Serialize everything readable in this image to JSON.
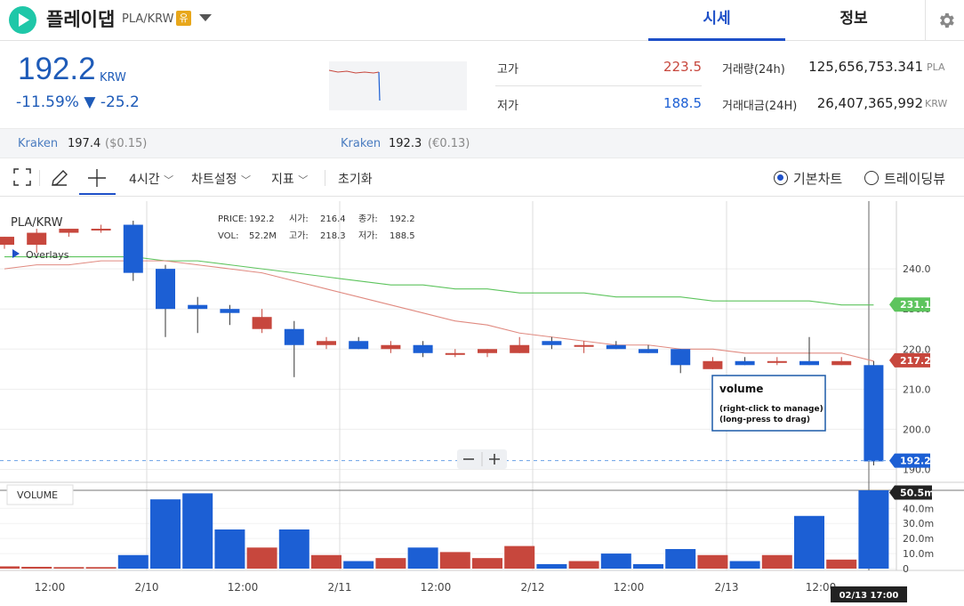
{
  "header": {
    "name": "플레이댑",
    "pair": "PLA/KRW",
    "badge": "유",
    "tabs": [
      {
        "label": "시세"
      },
      {
        "label": "정보"
      }
    ]
  },
  "price": {
    "value": "192.2",
    "unit": "KRW",
    "change": "-11.59% ▼ -25.2"
  },
  "stats": {
    "high_label": "고가",
    "high": "223.5",
    "low_label": "저가",
    "low": "188.5",
    "vol_label": "거래량(24h)",
    "vol": "125,656,753.341",
    "vol_unit": "PLA",
    "amt_label": "거래대금(24H)",
    "amt": "26,407,365,992",
    "amt_unit": "KRW"
  },
  "exchanges": [
    {
      "name": "Kraken",
      "price": "197.4",
      "fiat": "($0.15)"
    },
    {
      "name": "Kraken",
      "price": "192.3",
      "fiat": "(€0.13)"
    }
  ],
  "toolbar": {
    "interval": "4시간",
    "settings": "차트설정",
    "indicator": "지표",
    "reset": "초기화",
    "basic_chart": "기본차트",
    "tradingview": "트레이딩뷰"
  },
  "legend": {
    "pair": "PLA/KRW",
    "overlays": "Overlays",
    "price_label": "PRICE:",
    "price": "192.2",
    "open_label": "시가:",
    "open": "216.4",
    "close_label": "종가:",
    "close": "192.2",
    "vol_label": "VOL:",
    "vol": "52.2M",
    "high_label": "고가:",
    "high": "218.3",
    "low_label": "저가:",
    "low": "188.5"
  },
  "tooltip": {
    "title": "volume",
    "line1": "(right-click to manage)",
    "line2": "(long-press to drag)"
  },
  "volume_panel_label": "VOLUME",
  "crosshair_time": "02/13 17:00",
  "colors": {
    "up": "#c7473d",
    "down": "#1c5fd4",
    "ma_green": "#5dc45d",
    "ma_red": "#e08a80",
    "accent": "#1e50c8"
  },
  "chart_data": {
    "type": "candlestick",
    "price_axis": {
      "ticks": [
        190,
        200,
        210,
        220,
        230,
        240
      ],
      "labels": [
        "190.0",
        "200.0",
        "210.0",
        "220.0",
        "230.0",
        "240.0"
      ],
      "range": [
        187,
        258
      ]
    },
    "volume_axis": {
      "ticks": [
        0,
        10,
        20,
        30,
        40
      ],
      "labels": [
        "0",
        "10.0m",
        "20.0m",
        "30.0m",
        "40.0m"
      ],
      "range": [
        0,
        52
      ]
    },
    "x_labels": [
      "12:00",
      "2/10",
      "12:00",
      "2/11",
      "12:00",
      "2/12",
      "12:00",
      "2/13",
      "12:00"
    ],
    "price_markers": [
      {
        "label": "231.1",
        "value": 231.1,
        "color": "#5dc45d"
      },
      {
        "label": "217.2",
        "value": 217.2,
        "color": "#c7473d"
      },
      {
        "label": "192.2",
        "value": 192.2,
        "color": "#1c5fd4"
      }
    ],
    "volume_marker": {
      "label": "50.5m",
      "value": 50.5
    },
    "candles": [
      {
        "o": 246,
        "h": 248,
        "l": 245,
        "c": 248,
        "v": 1.5
      },
      {
        "o": 246,
        "h": 250,
        "l": 244,
        "c": 249,
        "v": 1.2
      },
      {
        "o": 249,
        "h": 250,
        "l": 248,
        "c": 250,
        "v": 1.0
      },
      {
        "o": 250,
        "h": 251,
        "l": 249,
        "c": 250,
        "v": 1.0
      },
      {
        "o": 251,
        "h": 252,
        "l": 237,
        "c": 239,
        "v": 9
      },
      {
        "o": 240,
        "h": 241,
        "l": 223,
        "c": 230,
        "v": 46
      },
      {
        "o": 231,
        "h": 233,
        "l": 224,
        "c": 230,
        "v": 50
      },
      {
        "o": 230,
        "h": 231,
        "l": 226,
        "c": 229,
        "v": 26
      },
      {
        "o": 225,
        "h": 230,
        "l": 224,
        "c": 228,
        "v": 14
      },
      {
        "o": 225,
        "h": 227,
        "l": 213,
        "c": 221,
        "v": 26
      },
      {
        "o": 221,
        "h": 223,
        "l": 220,
        "c": 222,
        "v": 9
      },
      {
        "o": 222,
        "h": 223,
        "l": 220,
        "c": 220,
        "v": 5
      },
      {
        "o": 220,
        "h": 222,
        "l": 219,
        "c": 221,
        "v": 7
      },
      {
        "o": 221,
        "h": 222,
        "l": 218,
        "c": 219,
        "v": 14
      },
      {
        "o": 219,
        "h": 220,
        "l": 218,
        "c": 219,
        "v": 11
      },
      {
        "o": 219,
        "h": 220,
        "l": 218,
        "c": 220,
        "v": 7
      },
      {
        "o": 219,
        "h": 223,
        "l": 219,
        "c": 221,
        "v": 15
      },
      {
        "o": 222,
        "h": 223,
        "l": 220,
        "c": 221,
        "v": 3
      },
      {
        "o": 221,
        "h": 222,
        "l": 219,
        "c": 221,
        "v": 5
      },
      {
        "o": 221,
        "h": 222,
        "l": 220,
        "c": 220,
        "v": 10
      },
      {
        "o": 220,
        "h": 221,
        "l": 219,
        "c": 219,
        "v": 3
      },
      {
        "o": 220,
        "h": 220,
        "l": 214,
        "c": 216,
        "v": 13
      },
      {
        "o": 215,
        "h": 218,
        "l": 215,
        "c": 217,
        "v": 9
      },
      {
        "o": 217,
        "h": 218,
        "l": 216,
        "c": 216,
        "v": 5
      },
      {
        "o": 217,
        "h": 218,
        "l": 216,
        "c": 217,
        "v": 9
      },
      {
        "o": 217,
        "h": 223,
        "l": 216,
        "c": 216,
        "v": 35
      },
      {
        "o": 216,
        "h": 218,
        "l": 216,
        "c": 217,
        "v": 6
      },
      {
        "o": 216,
        "h": 217,
        "l": 191,
        "c": 192,
        "v": 52
      }
    ],
    "ma_green": [
      243,
      243,
      243,
      243,
      243,
      242,
      242,
      241,
      240,
      239,
      238,
      237,
      236,
      236,
      235,
      235,
      234,
      234,
      234,
      233,
      233,
      233,
      232,
      232,
      232,
      232,
      231,
      231
    ],
    "ma_red": [
      240,
      241,
      241,
      242,
      242,
      242,
      241,
      240,
      239,
      237,
      235,
      233,
      231,
      229,
      227,
      226,
      224,
      223,
      222,
      221,
      221,
      220,
      220,
      219,
      219,
      219,
      219,
      217
    ]
  }
}
